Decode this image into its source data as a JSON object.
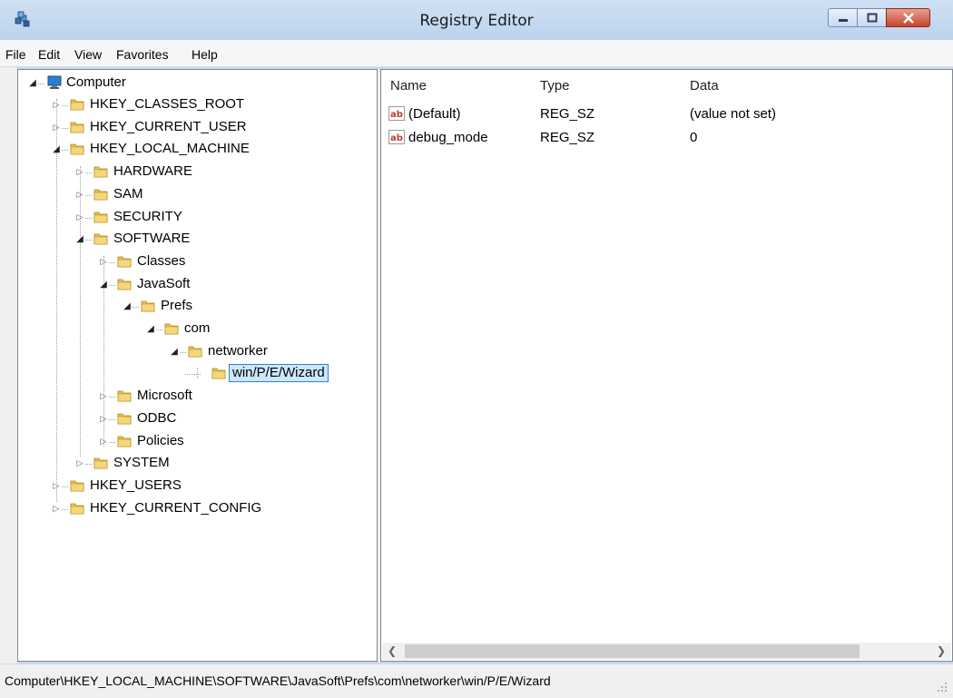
{
  "window": {
    "title": "Registry Editor",
    "icon": "registry-editor-icon"
  },
  "menu": [
    "File",
    "Edit",
    "View",
    "Favorites",
    "Help"
  ],
  "tree": {
    "root": "Computer",
    "items": [
      {
        "label": "HKEY_CLASSES_ROOT",
        "expanded": false
      },
      {
        "label": "HKEY_CURRENT_USER",
        "expanded": false
      },
      {
        "label": "HKEY_LOCAL_MACHINE",
        "expanded": true
      },
      {
        "label": "HARDWARE",
        "expanded": false
      },
      {
        "label": "SAM",
        "expanded": false
      },
      {
        "label": "SECURITY",
        "expanded": false
      },
      {
        "label": "SOFTWARE",
        "expanded": true
      },
      {
        "label": "Classes",
        "expanded": false
      },
      {
        "label": "JavaSoft",
        "expanded": true
      },
      {
        "label": "Prefs",
        "expanded": true
      },
      {
        "label": "com",
        "expanded": true
      },
      {
        "label": "networker",
        "expanded": true
      },
      {
        "label": "win/P/E/Wizard",
        "expanded": false,
        "selected": true
      },
      {
        "label": "Microsoft",
        "expanded": false
      },
      {
        "label": "ODBC",
        "expanded": false
      },
      {
        "label": "Policies",
        "expanded": false
      },
      {
        "label": "SYSTEM",
        "expanded": false
      },
      {
        "label": "HKEY_USERS",
        "expanded": false
      },
      {
        "label": "HKEY_CURRENT_CONFIG",
        "expanded": false
      }
    ]
  },
  "list": {
    "columns": [
      "Name",
      "Type",
      "Data"
    ],
    "rows": [
      {
        "name": "(Default)",
        "type": "REG_SZ",
        "data": "(value not set)",
        "icon": "string-value-icon"
      },
      {
        "name": "debug_mode",
        "type": "REG_SZ",
        "data": "0",
        "icon": "string-value-icon"
      }
    ]
  },
  "status": {
    "path": "Computer\\HKEY_LOCAL_MACHINE\\SOFTWARE\\JavaSoft\\Prefs\\com\\networker\\win/P/E/Wizard"
  },
  "colors": {
    "folder": "#e8c04a",
    "selection": "#cce8ff",
    "selection_border": "#2f7ed8",
    "close_button": "#c7452c"
  }
}
